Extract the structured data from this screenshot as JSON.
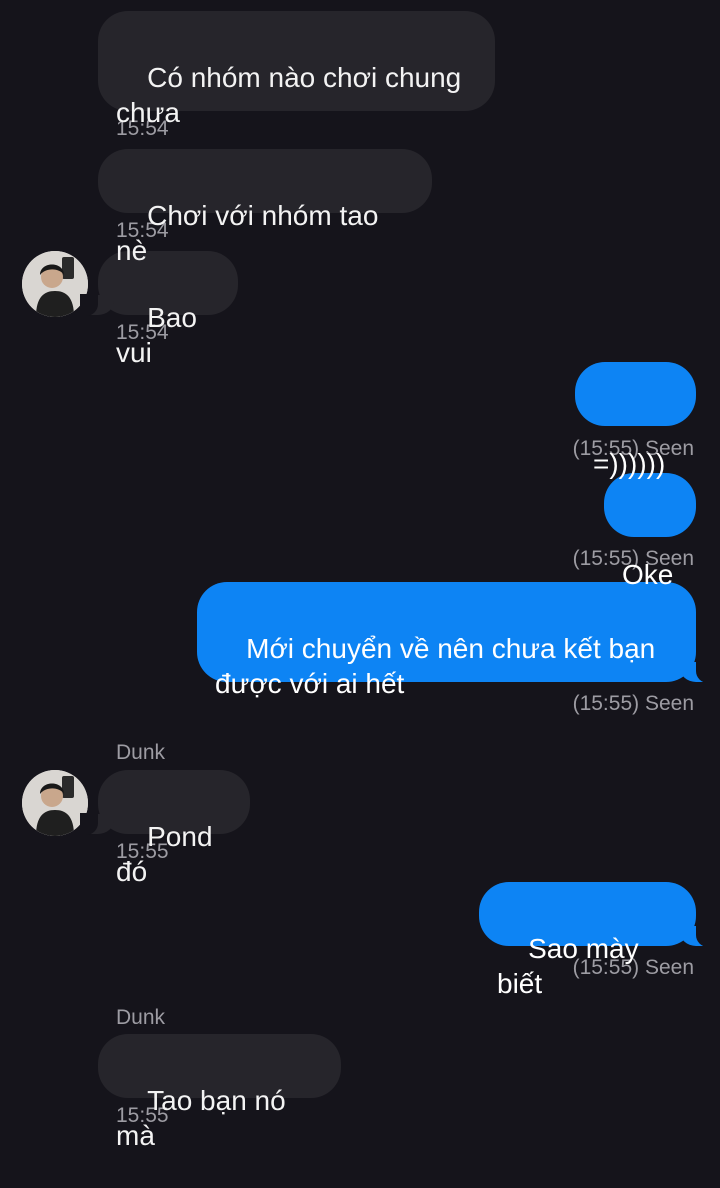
{
  "messages": [
    {
      "text": "Có nhóm nào chơi chung\nchưa",
      "time": "15:54"
    },
    {
      "text": "Chơi với nhóm tao nè",
      "time": "15:54"
    },
    {
      "text": "Bao vui",
      "time": "15:54"
    },
    {
      "text": "=))))))",
      "status": "(15:55) Seen"
    },
    {
      "text": "Oke",
      "status": "(15:55) Seen"
    },
    {
      "text": "Mới chuyển về nên chưa kết bạn\nđược với ai hết",
      "status": "(15:55) Seen"
    },
    {
      "sender": "Dunk",
      "text": "Pond đó",
      "time": "15:55"
    },
    {
      "text": "Sao mày biết",
      "status": "(15:55) Seen"
    },
    {
      "sender": "Dunk",
      "text": "Tao bạn nó mà",
      "time": "15:55"
    }
  ],
  "colors": {
    "background": "#15141b",
    "incoming_bubble": "#26252b",
    "outgoing_bubble": "#0d84f4",
    "meta_text": "#9d9ca3"
  },
  "icons": {
    "avatar": "contact-avatar-photo"
  }
}
